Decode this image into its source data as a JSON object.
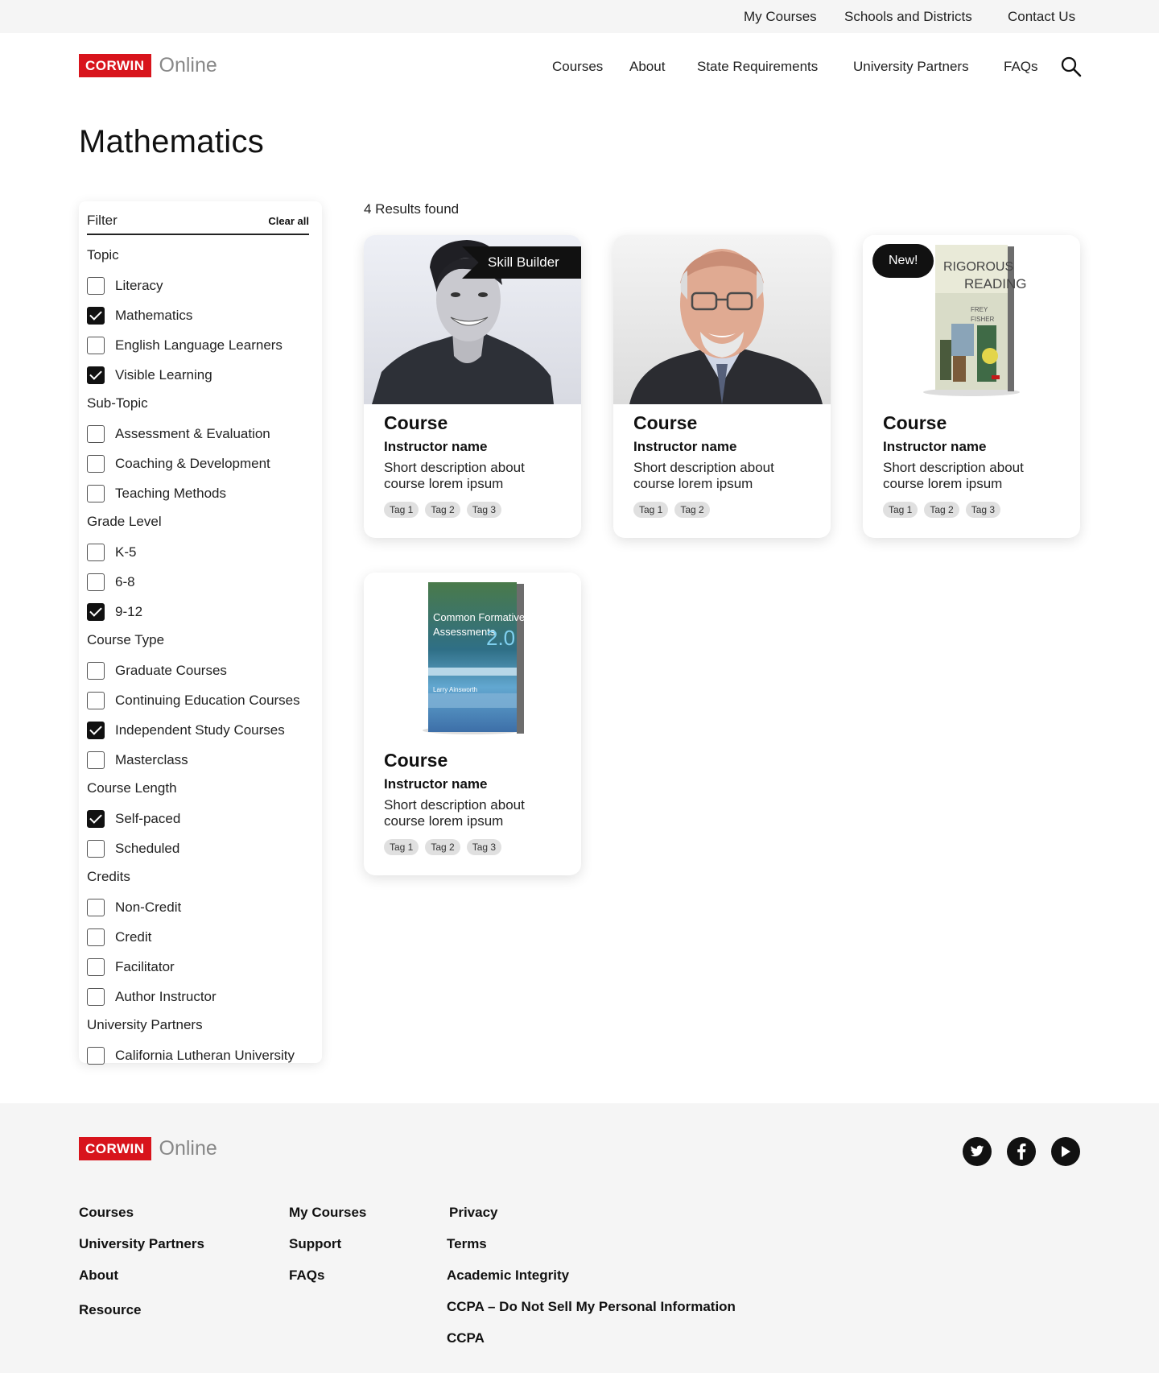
{
  "utility_nav": {
    "my_courses": "My Courses",
    "schools": "Schools and Districts",
    "contact": "Contact Us"
  },
  "brand": {
    "logo_box": "CORWIN",
    "logo_text": "Online",
    "color": "#d8141c"
  },
  "main_nav": {
    "courses": "Courses",
    "about": "About",
    "state_requirements": "State Requirements",
    "university_partners": "University Partners",
    "faqs": "FAQs",
    "search_icon": "search-icon"
  },
  "page": {
    "title": "Mathematics"
  },
  "filter": {
    "title": "Filter",
    "clear_all": "Clear all",
    "groups": [
      {
        "title": "Topic",
        "options": [
          {
            "label": "Literacy",
            "checked": false
          },
          {
            "label": "Mathematics",
            "checked": true
          },
          {
            "label": "English Language Learners",
            "checked": false
          },
          {
            "label": "Visible Learning",
            "checked": true
          }
        ]
      },
      {
        "title": "Sub-Topic",
        "options": [
          {
            "label": "Assessment & Evaluation",
            "checked": false
          },
          {
            "label": "Coaching & Development",
            "checked": false
          },
          {
            "label": "Teaching Methods",
            "checked": false
          }
        ]
      },
      {
        "title": "Grade Level",
        "options": [
          {
            "label": "K-5",
            "checked": false
          },
          {
            "label": "6-8",
            "checked": false
          },
          {
            "label": "9-12",
            "checked": true
          }
        ]
      },
      {
        "title": "Course Type",
        "options": [
          {
            "label": "Graduate Courses",
            "checked": false
          },
          {
            "label": "Continuing Education Courses",
            "checked": false
          },
          {
            "label": "Independent Study Courses",
            "checked": true
          },
          {
            "label": "Masterclass",
            "checked": false
          }
        ]
      },
      {
        "title": "Course Length",
        "options": [
          {
            "label": "Self-paced",
            "checked": true
          },
          {
            "label": "Scheduled",
            "checked": false
          }
        ]
      },
      {
        "title": "Credits",
        "options": [
          {
            "label": "Non-Credit",
            "checked": false
          },
          {
            "label": "Credit",
            "checked": false
          },
          {
            "label": "Facilitator",
            "checked": false
          },
          {
            "label": "Author Instructor",
            "checked": false
          }
        ]
      },
      {
        "title": "University Partners",
        "options": [
          {
            "label": "California Lutheran University",
            "checked": false
          }
        ]
      }
    ]
  },
  "results": {
    "count_text": "4 Results found"
  },
  "cards": [
    {
      "title": "Course",
      "instructor": "Instructor name",
      "description": "Short description about course lorem ipsum",
      "tags": [
        "Tag 1",
        "Tag 2",
        "Tag 3"
      ],
      "badge": "Skill Builder"
    },
    {
      "title": "Course",
      "instructor": "Instructor name",
      "description": "Short description about course lorem ipsum",
      "tags": [
        "Tag 1",
        "Tag 2"
      ],
      "badge": ""
    },
    {
      "title": "Course",
      "instructor": "Instructor name",
      "description": "Short description about course lorem ipsum",
      "tags": [
        "Tag 1",
        "Tag 2",
        "Tag 3"
      ],
      "badge": "New!"
    },
    {
      "title": "Course",
      "instructor": "Instructor name",
      "description": "Short description about course lorem ipsum",
      "tags": [
        "Tag 1",
        "Tag 2",
        "Tag 3"
      ],
      "badge": ""
    }
  ],
  "covers": {
    "book1": {
      "title_a": "RIGOROUS",
      "title_b": "READING",
      "authors_a": "FREY",
      "authors_b": "FISHER"
    },
    "book2": {
      "title_a": "Common Formative",
      "title_b": "Assessments",
      "version": "2.0",
      "author": "Larry Ainsworth"
    }
  },
  "footer": {
    "social": [
      "twitter-icon",
      "facebook-icon",
      "youtube-icon"
    ],
    "col1": [
      "Courses",
      "University Partners",
      "About",
      "Resource"
    ],
    "col2": [
      "My Courses",
      "Support",
      "FAQs"
    ],
    "col3": [
      "Privacy",
      "Terms",
      "Academic Integrity",
      "CCPA – Do Not Sell My Personal Information",
      "CCPA"
    ]
  }
}
